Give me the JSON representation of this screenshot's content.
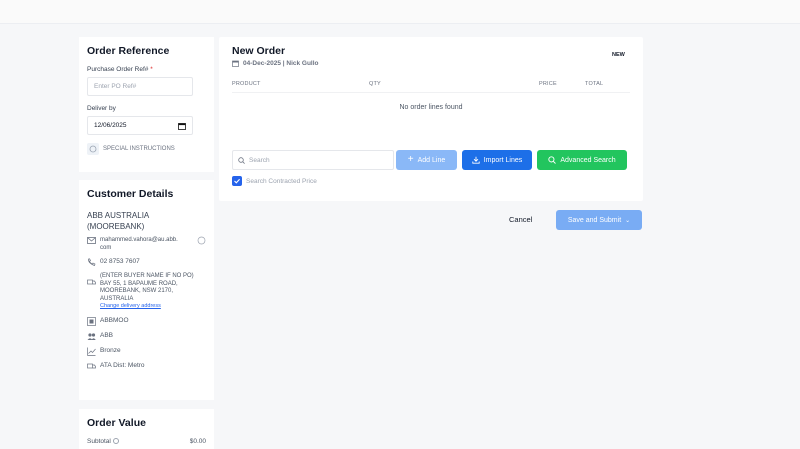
{
  "order_reference": {
    "title": "Order Reference",
    "po_label": "Purchase Order Ref#",
    "po_required": "*",
    "po_placeholder": "Enter PO Ref#",
    "deliver_label": "Deliver by",
    "deliver_value": "12/06/2025",
    "special_instructions": "SPECIAL INSTRUCTIONS"
  },
  "customer": {
    "title": "Customer Details",
    "name_line1": "ABB AUSTRALIA",
    "name_line2": "(MOOREBANK)",
    "email_line1": "mahammed.vahora@au.abb.",
    "email_line2": "com",
    "phone": "02 8753 7607",
    "address_line1": "(ENTER BUYER NAME IF NO PO)",
    "address_line2": "BAY 55, 1 BAPAUME ROAD,",
    "address_line3": "MOOREBANK, NSW 2170,",
    "address_line4": "AUSTRALIA",
    "change_address": "Change delivery address",
    "code": "ABBMOO",
    "group": "ABB",
    "tier": "Bronze",
    "dist": "ATA Dist: Metro"
  },
  "order_value": {
    "title": "Order Value",
    "subtotal_label": "Subtotal",
    "subtotal_value": "$0.00"
  },
  "new_order": {
    "title": "New Order",
    "meta": "04-Dec-2025 | Nick Gullo",
    "status_badge": "NEW",
    "columns": {
      "product": "PRODUCT",
      "qty": "QTY",
      "price": "PRICE",
      "total": "TOTAL"
    },
    "empty_message": "No order lines found",
    "search_placeholder": "Search",
    "add_line": "Add Line",
    "import_lines": "Import Lines",
    "advanced_search": "Advanced Search",
    "contracted_price": "Search Contracted Price"
  },
  "actions": {
    "cancel": "Cancel",
    "save_submit": "Save and Submit"
  },
  "colors": {
    "add_line": "#8ab8f7",
    "import_lines": "#1d6fe8",
    "advanced_search": "#22c55e",
    "save_submit": "#79acf4",
    "checkbox": "#2563eb"
  }
}
